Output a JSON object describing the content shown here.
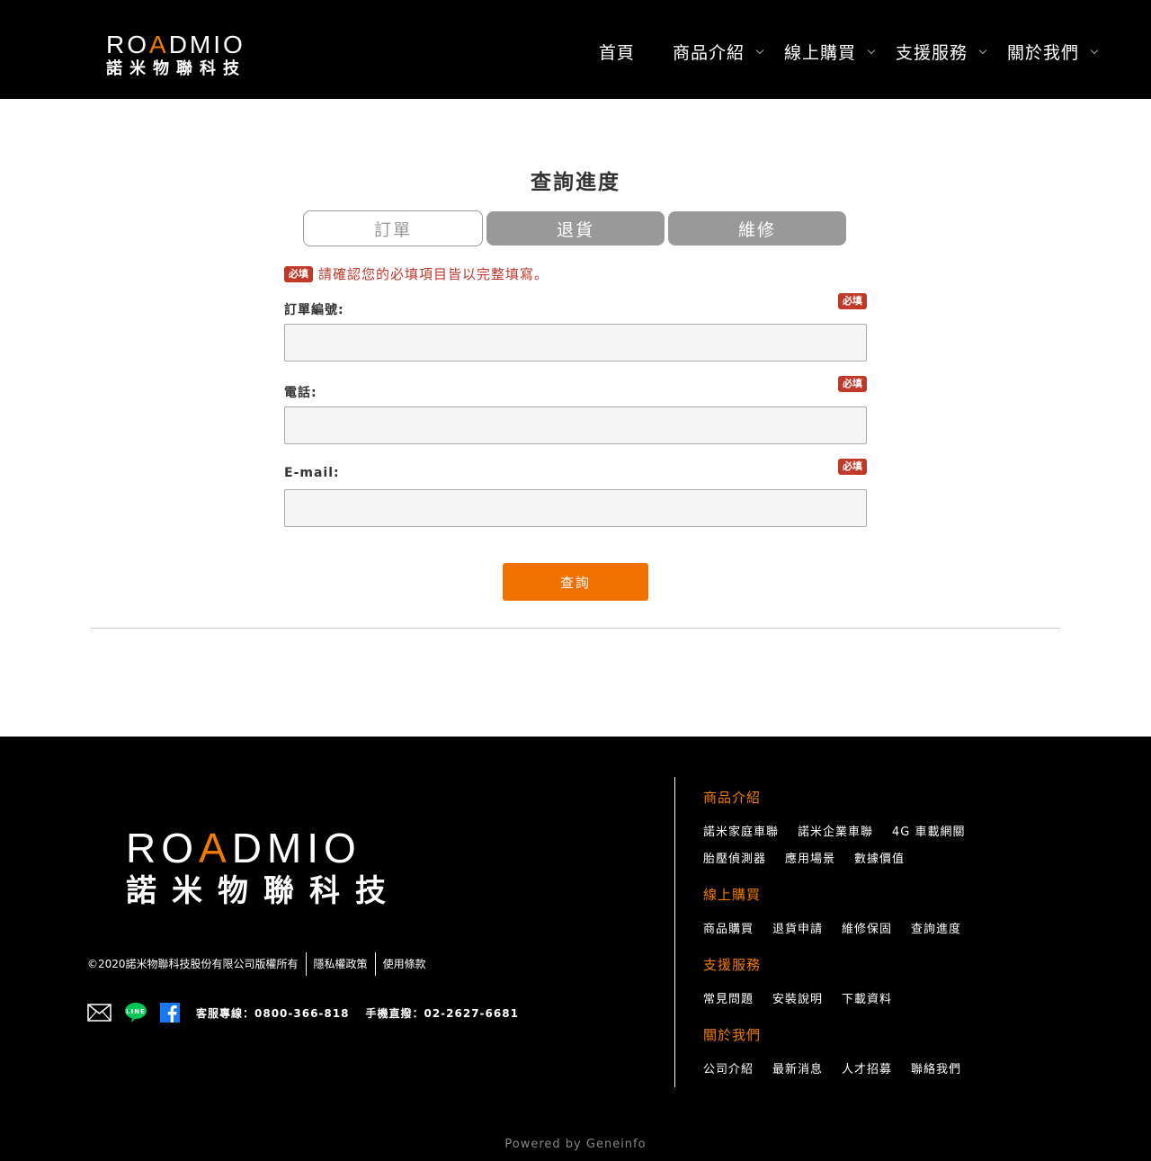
{
  "header": {
    "logo_word_pre": "RO",
    "logo_word_accent": "A",
    "logo_word_post": "DMIO",
    "logo_cn": "諾米物聯科技",
    "nav": [
      "首頁",
      "商品介紹",
      "線上購買",
      "支援服務",
      "關於我們"
    ]
  },
  "main": {
    "title": "查詢進度",
    "tabs": [
      "訂單",
      "退貨",
      "維修"
    ],
    "required_badge": "必填",
    "notice": "請確認您的必填項目皆以完整填寫。",
    "fields": [
      {
        "label": "訂單編號:",
        "value": ""
      },
      {
        "label": "電話:",
        "value": ""
      },
      {
        "label": "E-mail:",
        "value": ""
      }
    ],
    "submit_label": "查詢"
  },
  "footer": {
    "copyright": "©2020諾米物聯科技股份有限公司版權所有",
    "privacy": "隱私權政策",
    "terms": "使用條款",
    "service_line": "客服專線：0800-366-818",
    "mobile_line": "手機直撥：02-2627-6681",
    "sections": [
      {
        "title": "商品介紹",
        "links": [
          "諾米家庭車聯",
          "諾米企業車聯",
          "4G 車載網關",
          "胎壓偵測器",
          "應用場景",
          "數據價值"
        ]
      },
      {
        "title": "線上購買",
        "links": [
          "商品購買",
          "退貨申請",
          "維修保固",
          "查詢進度"
        ]
      },
      {
        "title": "支援服務",
        "links": [
          "常見問題",
          "安裝說明",
          "下載資料"
        ]
      },
      {
        "title": "關於我們",
        "links": [
          "公司介紹",
          "最新消息",
          "人才招募",
          "聯絡我們"
        ]
      }
    ],
    "powered": "Powered by Geneinfo"
  },
  "colors": {
    "accent": "#f07000",
    "required": "#c0392b",
    "tab_inactive": "#999999"
  }
}
